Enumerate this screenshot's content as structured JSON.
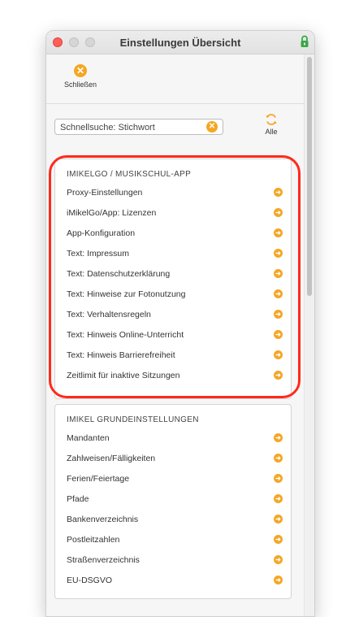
{
  "window": {
    "title": "Einstellungen Übersicht"
  },
  "toolbar": {
    "close_label": "Schließen"
  },
  "search": {
    "value": "Schnellsuche: Stichwort",
    "all_label": "Alle"
  },
  "sections": [
    {
      "title": "IMIKELGO / MUSIKSCHUL-APP",
      "items": [
        "Proxy-Einstellungen",
        "iMikelGo/App: Lizenzen",
        "App-Konfiguration",
        "Text: Impressum",
        "Text: Datenschutzerklärung",
        "Text: Hinweise zur Fotonutzung",
        "Text: Verhaltensregeln",
        "Text: Hinweis Online-Unterricht",
        "Text: Hinweis Barrierefreiheit",
        "Zeitlimit für inaktive Sitzungen"
      ]
    },
    {
      "title": "IMIKEL GRUNDEINSTELLUNGEN",
      "items": [
        "Mandanten",
        "Zahlweisen/Fälligkeiten",
        "Ferien/Feiertage",
        "Pfade",
        "Bankenverzeichnis",
        "Postleitzahlen",
        "Straßenverzeichnis",
        "EU-DSGVO"
      ]
    }
  ],
  "colors": {
    "accent": "#f5a623",
    "highlight": "#ff2a1a"
  },
  "icons": {
    "close": "x-circle-icon",
    "clear": "x-circle-icon",
    "refresh": "refresh-icon",
    "row": "arrow-right-circle-icon",
    "lock": "lock-icon"
  }
}
